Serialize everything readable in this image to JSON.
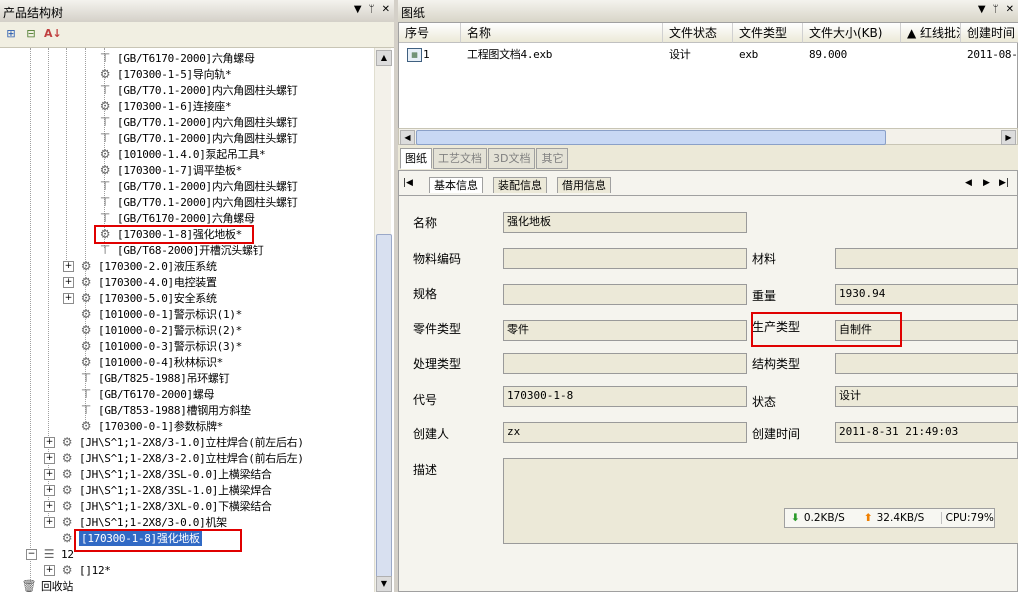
{
  "left_panel": {
    "title": "产品结构树",
    "controls": [
      "▼",
      "ᛘ",
      "✕"
    ],
    "tree": [
      {
        "label": "[GB/T6170-2000]六角螺母",
        "icon": "bolt-icon"
      },
      {
        "label": "[170300-1-5]导向轨*",
        "icon": "gear-icon"
      },
      {
        "label": "[GB/T70.1-2000]内六角圆柱头螺钉",
        "icon": "bolt-icon"
      },
      {
        "label": "[170300-1-6]连接座*",
        "icon": "gear-icon"
      },
      {
        "label": "[GB/T70.1-2000]内六角圆柱头螺钉",
        "icon": "bolt-icon"
      },
      {
        "label": "[GB/T70.1-2000]内六角圆柱头螺钉",
        "icon": "bolt-icon"
      },
      {
        "label": "[101000-1.4.0]泵起吊工具*",
        "icon": "gear-icon"
      },
      {
        "label": "[170300-1-7]调平垫板*",
        "icon": "gear-icon"
      },
      {
        "label": "[GB/T70.1-2000]内六角圆柱头螺钉",
        "icon": "bolt-icon"
      },
      {
        "label": "[GB/T70.1-2000]内六角圆柱头螺钉",
        "icon": "bolt-icon"
      },
      {
        "label": "[GB/T6170-2000]六角螺母",
        "icon": "bolt-icon"
      },
      {
        "label": "[170300-1-8]强化地板*",
        "icon": "gear-icon"
      },
      {
        "label": "[GB/T68-2000]开槽沉头螺钉",
        "icon": "bolt-icon"
      },
      {
        "label": "[170300-2.0]液压系统",
        "icon": "gear-icon"
      },
      {
        "label": "[170300-4.0]电控装置",
        "icon": "gear-icon"
      },
      {
        "label": "[170300-5.0]安全系统",
        "icon": "gear-icon"
      },
      {
        "label": "[101000-0-1]警示标识(1)*",
        "icon": "gear-icon"
      },
      {
        "label": "[101000-0-2]警示标识(2)*",
        "icon": "gear-icon"
      },
      {
        "label": "[101000-0-3]警示标识(3)*",
        "icon": "gear-icon"
      },
      {
        "label": "[101000-0-4]秋林标识*",
        "icon": "gear-icon"
      },
      {
        "label": "[GB/T825-1988]吊环螺钉",
        "icon": "bolt-icon"
      },
      {
        "label": "[GB/T6170-2000]螺母",
        "icon": "bolt-icon"
      },
      {
        "label": "[GB/T853-1988]槽钢用方斜垫",
        "icon": "bolt-icon"
      },
      {
        "label": "[170300-0-1]参数标牌*",
        "icon": "gear-icon"
      },
      {
        "label": "[JH\\S^1;1-2X8/3-1.0]立柱焊合(前左后右)",
        "icon": "gears-icon"
      },
      {
        "label": "[JH\\S^1;1-2X8/3-2.0]立柱焊合(前右后左)",
        "icon": "gears-icon"
      },
      {
        "label": "[JH\\S^1;1-2X8/3SL-0.0]上横梁结合",
        "icon": "gears-icon"
      },
      {
        "label": "[JH\\S^1;1-2X8/3SL-1.0]上横梁焊合",
        "icon": "gears-icon"
      },
      {
        "label": "[JH\\S^1;1-2X8/3XL-0.0]下横梁结合",
        "icon": "gears-icon"
      },
      {
        "label": "[JH\\S^1;1-2X8/3-0.0]机架",
        "icon": "gears-icon"
      },
      {
        "label": "[170300-1-8]强化地板",
        "icon": "gears-icon"
      },
      {
        "label": "12",
        "icon": "list-icon"
      },
      {
        "label": "[]12*",
        "icon": "gears-icon"
      },
      {
        "label": "回收站",
        "icon": "trash-icon"
      }
    ]
  },
  "right_panel": {
    "title": "图纸",
    "controls": [
      "▼",
      "ᛘ",
      "✕"
    ],
    "columns": [
      "序号",
      "名称",
      "文件状态",
      "文件类型",
      "文件大小(KB)",
      "▲ 红线批注",
      "创建时间"
    ],
    "rows": [
      {
        "index": "1",
        "name": "工程图文档4.exb",
        "status": "设计",
        "type": "exb",
        "size": "89.000",
        "created": "2011-08-"
      }
    ],
    "tabs": [
      "图纸",
      "工艺文档",
      "3D文档",
      "其它"
    ],
    "subtabs": [
      "基本信息",
      "装配信息",
      "借用信息"
    ],
    "nav_arrows": [
      "◀",
      "▶",
      "▶|"
    ],
    "form": {
      "name_label": "名称",
      "name_value": "强化地板",
      "material_code_label": "物料编码",
      "material_code_value": "",
      "material_label": "材料",
      "material_value": "",
      "spec_label": "规格",
      "spec_value": "",
      "weight_label": "重量",
      "weight_value": "1930.94",
      "part_type_label": "零件类型",
      "part_type_value": "零件",
      "production_type_label": "生产类型",
      "production_type_value": "自制件",
      "process_type_label": "处理类型",
      "process_type_value": "",
      "structure_type_label": "结构类型",
      "structure_type_value": "",
      "code_label": "代号",
      "code_value": "170300-1-8",
      "state_label": "状态",
      "state_value": "设计",
      "creator_label": "创建人",
      "creator_value": "zx",
      "create_time_label": "创建时间",
      "create_time_value": "2011-8-31 21:49:03",
      "desc_label": "描述",
      "desc_value": ""
    },
    "netmeter": {
      "down": "0.2KB/S",
      "up": "32.4KB/S",
      "cpu": "CPU:79%"
    }
  },
  "colors": {
    "highlight_red": "#e00000",
    "selection_blue": "#316ac5"
  }
}
